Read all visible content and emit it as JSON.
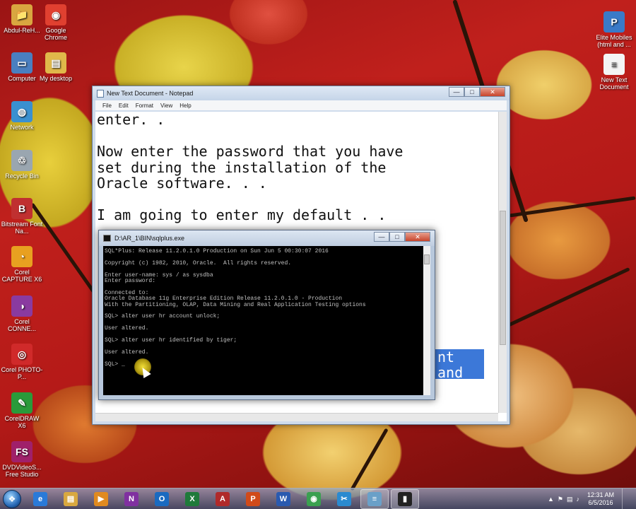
{
  "desktop_icons_left": [
    {
      "label": "Abdul-ReH...",
      "icon": "folder-user-icon",
      "color": "#d9a640"
    },
    {
      "label": "Google Chrome",
      "icon": "chrome-icon",
      "color": "#e04030"
    },
    {
      "label": "Computer",
      "icon": "computer-icon",
      "color": "#4a7fc0"
    },
    {
      "label": "My desktop",
      "icon": "folder-icon",
      "color": "#e0b84a"
    },
    {
      "label": "Network",
      "icon": "network-icon",
      "color": "#3a90d0"
    },
    {
      "label": "Recycle Bin",
      "icon": "recycle-bin-icon",
      "color": "#9aa6b0"
    },
    {
      "label": "Bitstream Font Na...",
      "icon": "bitstream-icon",
      "color": "#c03030"
    },
    {
      "label": "Corel CAPTURE X6",
      "icon": "corel-capture-icon",
      "color": "#e8a020"
    },
    {
      "label": "Corel CONNE...",
      "icon": "corel-connect-icon",
      "color": "#8a3aa0"
    },
    {
      "label": "Corel PHOTO-P...",
      "icon": "corel-photopaint-icon",
      "color": "#d02a2a"
    },
    {
      "label": "CorelDRAW X6",
      "icon": "coreldraw-icon",
      "color": "#2a9a3a"
    },
    {
      "label": "DVDVideoS... Free Studio",
      "icon": "dvdvideosoft-icon",
      "color": "#a0206a"
    }
  ],
  "desktop_icons_right": [
    {
      "label": "Elite Mobiles (html and ...",
      "icon": "powerpoint-file-icon",
      "color": "#3a7ac8"
    },
    {
      "label": "New Text Document",
      "icon": "text-file-icon",
      "color": "#f4f4f4"
    }
  ],
  "notepad": {
    "title": "New Text Document - Notepad",
    "menu": [
      "File",
      "Edit",
      "Format",
      "View",
      "Help"
    ],
    "text": "enter. .\n\nNow enter the password that you have\nset during the installation of the\nOracle software. . .\n\nI am going to enter my default . .",
    "selected_text": "nt\nand"
  },
  "cmd": {
    "title": "D:\\AR_1\\BIN\\sqlplus.exe",
    "output": "SQL*Plus: Release 11.2.0.1.0 Production on Sun Jun 5 00:30:07 2016\n\nCopyright (c) 1982, 2010, Oracle.  All rights reserved.\n\nEnter user-name: sys / as sysdba\nEnter password:\n\nConnected to:\nOracle Database 11g Enterprise Edition Release 11.2.0.1.0 - Production\nWith the Partitioning, OLAP, Data Mining and Real Application Testing options\n\nSQL> alter user hr account unlock;\n\nUser altered.\n\nSQL> alter user hr identified by tiger;\n\nUser altered.\n\nSQL> _"
  },
  "taskbar": {
    "buttons": [
      {
        "name": "ie",
        "glyph": "e",
        "color": "#2a7ad8",
        "active": false
      },
      {
        "name": "explorer",
        "glyph": "▤",
        "color": "#d8a840",
        "active": false
      },
      {
        "name": "media-player",
        "glyph": "▶",
        "color": "#e08a20",
        "active": false
      },
      {
        "name": "onenote",
        "glyph": "N",
        "color": "#8030a0",
        "active": false
      },
      {
        "name": "outlook",
        "glyph": "O",
        "color": "#1a6ac0",
        "active": false
      },
      {
        "name": "excel",
        "glyph": "X",
        "color": "#1f7a3a",
        "active": false
      },
      {
        "name": "access",
        "glyph": "A",
        "color": "#b02a2a",
        "active": false
      },
      {
        "name": "powerpoint",
        "glyph": "P",
        "color": "#d04a1a",
        "active": false
      },
      {
        "name": "word",
        "glyph": "W",
        "color": "#2a5ab0",
        "active": false
      },
      {
        "name": "chrome",
        "glyph": "◉",
        "color": "#3aa050",
        "active": false
      },
      {
        "name": "snipping",
        "glyph": "✂",
        "color": "#2a8ad0",
        "active": false
      },
      {
        "name": "notepad",
        "glyph": "≡",
        "color": "#6aa0c8",
        "active": true
      },
      {
        "name": "cmd",
        "glyph": "▮",
        "color": "#222222",
        "active": true
      }
    ],
    "clock_time": "12:31 AM",
    "clock_date": "6/5/2016"
  }
}
